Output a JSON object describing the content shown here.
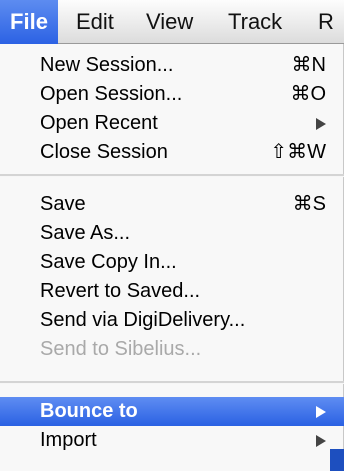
{
  "menubar": {
    "items": [
      {
        "label": "File",
        "active": true
      },
      {
        "label": "Edit"
      },
      {
        "label": "View"
      },
      {
        "label": "Track"
      },
      {
        "label": "R"
      }
    ]
  },
  "menu": {
    "groups": [
      {
        "items": [
          {
            "label": "New Session...",
            "shortcut": "⌘N"
          },
          {
            "label": "Open Session...",
            "shortcut": "⌘O"
          },
          {
            "label": "Open Recent",
            "submenu": true
          },
          {
            "label": "Close Session",
            "shortcut": "⇧⌘W"
          }
        ]
      },
      {
        "items": [
          {
            "label": "Save",
            "shortcut": "⌘S"
          },
          {
            "label": "Save As..."
          },
          {
            "label": "Save Copy In..."
          },
          {
            "label": "Revert to Saved..."
          },
          {
            "label": "Send via DigiDelivery..."
          },
          {
            "label": "Send to Sibelius...",
            "disabled": true
          }
        ]
      },
      {
        "items": [
          {
            "label": "Bounce to",
            "submenu": true,
            "highlighted": true
          },
          {
            "label": "Import",
            "submenu": true
          }
        ]
      }
    ]
  },
  "colors": {
    "highlight": "#2a61e3",
    "disabled_text": "#a9a9a9"
  }
}
